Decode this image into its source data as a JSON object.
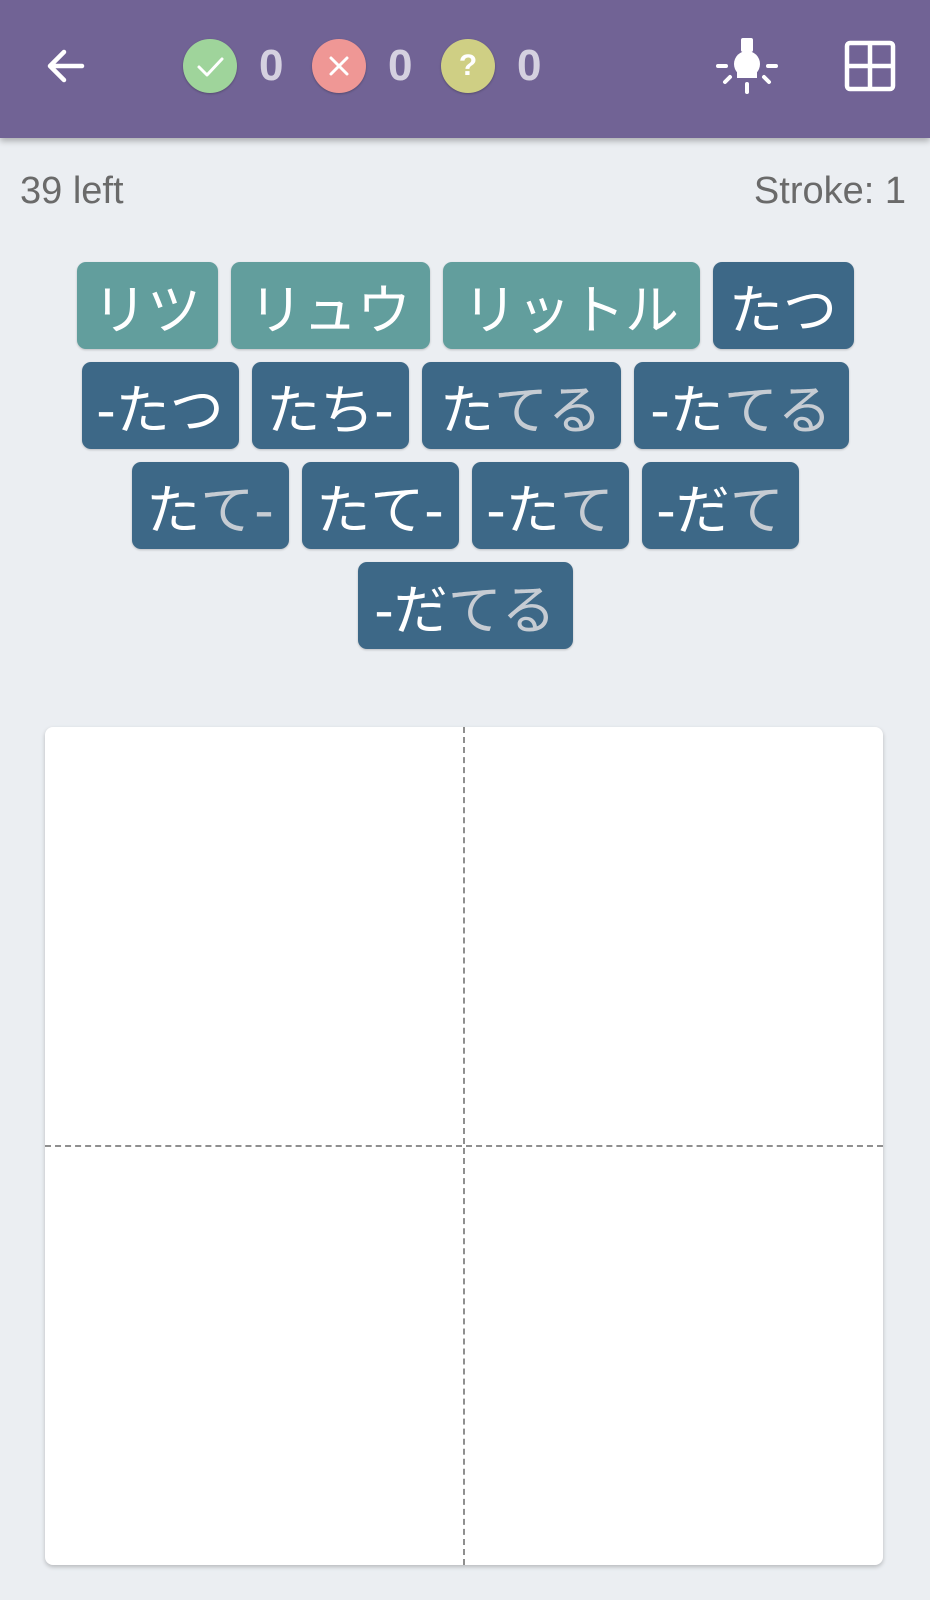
{
  "toolbar": {
    "back_icon": "arrow-left-icon",
    "correct_count": "0",
    "wrong_count": "0",
    "unknown_count": "0",
    "hint_icon": "lightbulb-icon",
    "grid_icon": "grid-icon"
  },
  "status": {
    "remaining": "39 left",
    "stroke": "Stroke: 1"
  },
  "readings": {
    "on": [
      "リツ",
      "リュウ",
      "リットル"
    ],
    "kun": [
      {
        "stem": "たつ",
        "okurigana": ""
      },
      {
        "stem": "-たつ",
        "okurigana": ""
      },
      {
        "stem": "たち-",
        "okurigana": ""
      },
      {
        "stem": "た",
        "okurigana": "てる"
      },
      {
        "stem": "-た",
        "okurigana": "てる"
      },
      {
        "stem": "た",
        "okurigana": "て-"
      },
      {
        "stem": "たて-",
        "okurigana": ""
      },
      {
        "stem": "-た",
        "okurigana": "て"
      },
      {
        "stem": "-だ",
        "okurigana": "て"
      },
      {
        "stem": "-だ",
        "okurigana": "てる"
      }
    ]
  },
  "colors": {
    "appbar": "#716395",
    "background": "#ebeef2",
    "on_chip": "#629e9d",
    "kun_chip": "#3d6887",
    "correct": "#9fd49b",
    "wrong": "#ef9795",
    "unknown": "#cfcf84"
  }
}
